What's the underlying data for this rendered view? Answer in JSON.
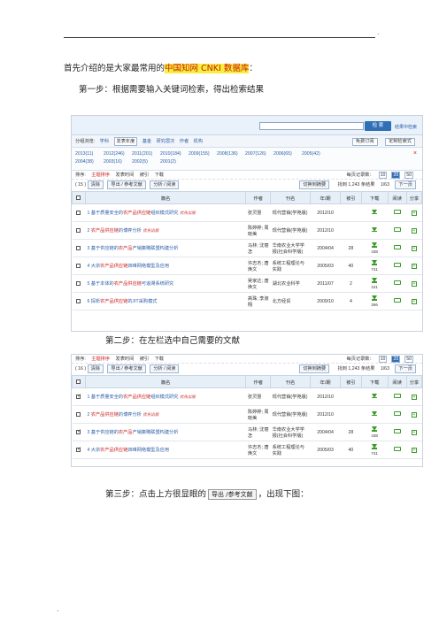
{
  "doc": {
    "intro_prefix": "首先介绍的是大家最常用的",
    "intro_highlight": "中国知网 CNKI 数据库",
    "intro_suffix": "：",
    "step1": "第一步：根据需要输入关键词检索，得出检索结果",
    "step2": "第二步：在左栏选中自己需要的文献",
    "step3_prefix": "第三步：点击上方很显眼的",
    "step3_suffix": "，出现下图：",
    "step3_button": "导出 /参考文献",
    "corner_mark": ".",
    "bottom_mark": "."
  },
  "panel1": {
    "search_button": "检  索",
    "adv_link": "结果中检索",
    "group_label": "分组浏览:",
    "groups": [
      "学科",
      "发表年度",
      "基金",
      "研究层次",
      "作者",
      "机构"
    ],
    "group_right": [
      "免费订阅",
      "定制检索式"
    ],
    "years": [
      "2013(11)",
      "2012(246)",
      "2011(201)",
      "2010(184)",
      "2009(155)",
      "2008(136)",
      "2007(126)",
      "2006(65)",
      "2005(42)",
      "2004(38)",
      "2003(16)",
      "2002(5)",
      "2001(2)"
    ],
    "close_x": "×",
    "sort_label": "排序:",
    "sorts": [
      "主题排序",
      "发表时间",
      "被引",
      "下载"
    ],
    "per_page_label": "每页记录数：",
    "per_page": [
      "10",
      "20",
      "50"
    ],
    "selected_count": "( 15 )",
    "tools": [
      "清除",
      "导出 / 参考文献",
      "分析 / 阅读"
    ],
    "toggle": "切换到摘要",
    "found": "找到 1,243 条结果",
    "page": "1/63",
    "next": "下一页",
    "headers": [
      "",
      "篇名",
      "作者",
      "刊名",
      "年/期",
      "被引",
      "下载",
      "阅读",
      "分享"
    ],
    "rows": [
      {
        "n": "1",
        "pre": "基于质量安全的",
        "kw": "农产品供应链",
        "post": "组织模式研究",
        "tag": "优先出版",
        "author": "张灵慧",
        "journal": "现代营销(学苑版)",
        "year": "2012/10",
        "cites": "",
        "downloads": ""
      },
      {
        "n": "2",
        "pre": "",
        "kw": "农产品供应链",
        "post": "的博弈分析",
        "tag": "优先出版",
        "author": "陈婷婷; 周晓美",
        "journal": "现代营销(学苑版)",
        "year": "2012/10",
        "cites": "",
        "downloads": ""
      },
      {
        "n": "3",
        "pre": "基于供应链的",
        "kw": "农产品",
        "post": "产销策略联盟构建分析",
        "tag": "",
        "author": "马林; 沈丽怎",
        "journal": "华南农业大学学报(社会科学版)",
        "year": "2004/04",
        "cites": "28",
        "downloads": "438"
      },
      {
        "n": "4",
        "pre": "大宗",
        "kw": "农产品供应链",
        "post": "四维网络模型及应用",
        "tag": "",
        "author": "许志杰; 唐焕文",
        "journal": "系统工程理论与实践",
        "year": "2005/03",
        "cites": "40",
        "downloads": "741"
      },
      {
        "n": "5",
        "pre": "基于本体的",
        "kw": "农产品供应链",
        "post": "可追溯系统研究",
        "tag": "",
        "author": "吴家达; 唐焕文",
        "journal": "湖北农业科学",
        "year": "2011/07",
        "cites": "2",
        "downloads": "241"
      },
      {
        "n": "6",
        "pre": "探析",
        "kw": "农产品供应链",
        "post": "的JIT采购模式",
        "tag": "",
        "author": "高珠; 李淑翔",
        "journal": "北方经贸",
        "year": "2009/10",
        "cites": "4",
        "downloads": "266"
      }
    ]
  },
  "panel2": {
    "selected_count": "( 16 )",
    "checked": [
      true,
      false,
      true,
      true
    ]
  }
}
